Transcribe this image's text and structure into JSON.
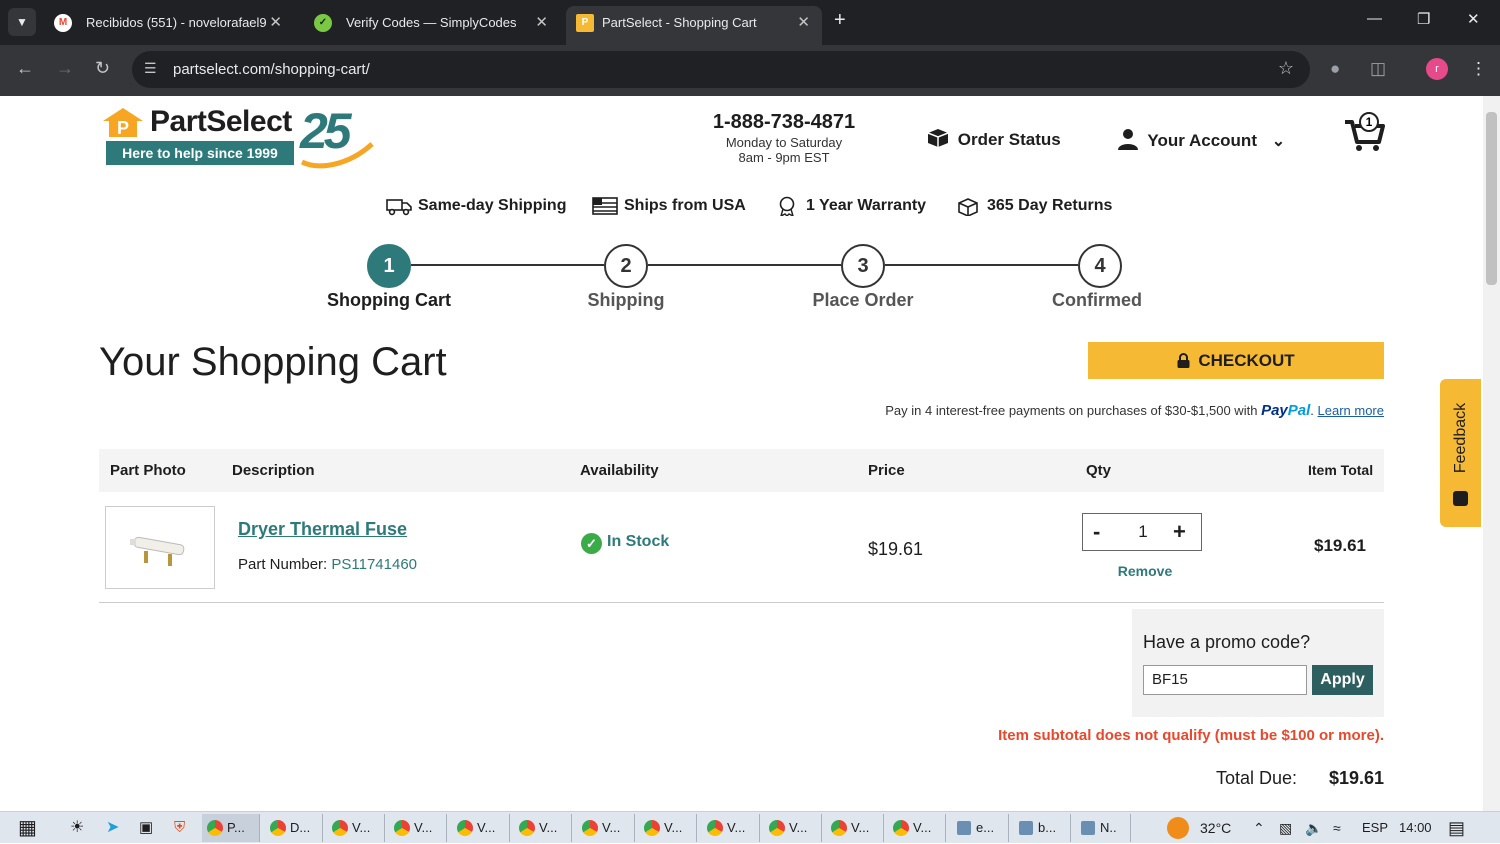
{
  "browser": {
    "tabs": [
      {
        "title": "Recibidos (551) - novelorafael9",
        "favicon": "gmail-icon"
      },
      {
        "title": "Verify Codes — SimplyCodes",
        "favicon": "simplycodes-icon"
      },
      {
        "title": "PartSelect - Shopping Cart",
        "favicon": "partselect-icon",
        "active": true
      }
    ],
    "url": "partselect.com/shopping-cart/",
    "profile_initial": "r"
  },
  "header": {
    "brand": "PartSelect",
    "tagline": "Here to help since 1999",
    "anniversary": "25",
    "phone": "1-888-738-4871",
    "hours_line1": "Monday to Saturday",
    "hours_line2": "8am - 9pm EST",
    "order_status": "Order Status",
    "account": "Your Account",
    "cart_count": "1"
  },
  "benefits": [
    {
      "label": "Same-day Shipping",
      "icon": "truck-icon"
    },
    {
      "label": "Ships from USA",
      "icon": "flag-icon"
    },
    {
      "label": "1 Year Warranty",
      "icon": "ribbon-icon"
    },
    {
      "label": "365 Day Returns",
      "icon": "box-return-icon"
    }
  ],
  "steps": [
    {
      "num": "1",
      "label": "Shopping Cart",
      "active": true
    },
    {
      "num": "2",
      "label": "Shipping"
    },
    {
      "num": "3",
      "label": "Place Order"
    },
    {
      "num": "4",
      "label": "Confirmed"
    }
  ],
  "cart": {
    "title": "Your Shopping Cart",
    "checkout_label": "CHECKOUT",
    "paypal_text": "Pay in 4 interest-free payments on purchases of $30-$1,500 with",
    "paypal_brand_a": "Pay",
    "paypal_brand_b": "Pal",
    "learn_more": "Learn more",
    "columns": {
      "photo": "Part Photo",
      "description": "Description",
      "availability": "Availability",
      "price": "Price",
      "qty": "Qty",
      "total": "Item Total"
    },
    "items": [
      {
        "name": "Dryer Thermal Fuse",
        "part_number_label": "Part Number:",
        "part_number": "PS11741460",
        "availability": "In Stock",
        "price": "$19.61",
        "qty": "1",
        "remove": "Remove",
        "item_total": "$19.61"
      }
    ],
    "promo": {
      "title": "Have a promo code?",
      "code": "BF15",
      "apply": "Apply",
      "error": "Item subtotal does not qualify (must be $100 or more)."
    },
    "total_label": "Total Due:",
    "total_value": "$19.61"
  },
  "feedback_label": "Feedback",
  "taskbar": {
    "apps": [
      "P...",
      "D...",
      "V...",
      "V...",
      "V...",
      "V...",
      "V...",
      "V...",
      "V...",
      "V...",
      "V...",
      "V...",
      "e...",
      "b...",
      "N.."
    ],
    "temperature": "32°C",
    "language": "ESP",
    "time": "14:00"
  },
  "colors": {
    "brand_teal": "#2e7a7b",
    "checkout_yellow": "#f6b934",
    "error_red": "#e8482c",
    "stock_green": "#3bab49"
  }
}
